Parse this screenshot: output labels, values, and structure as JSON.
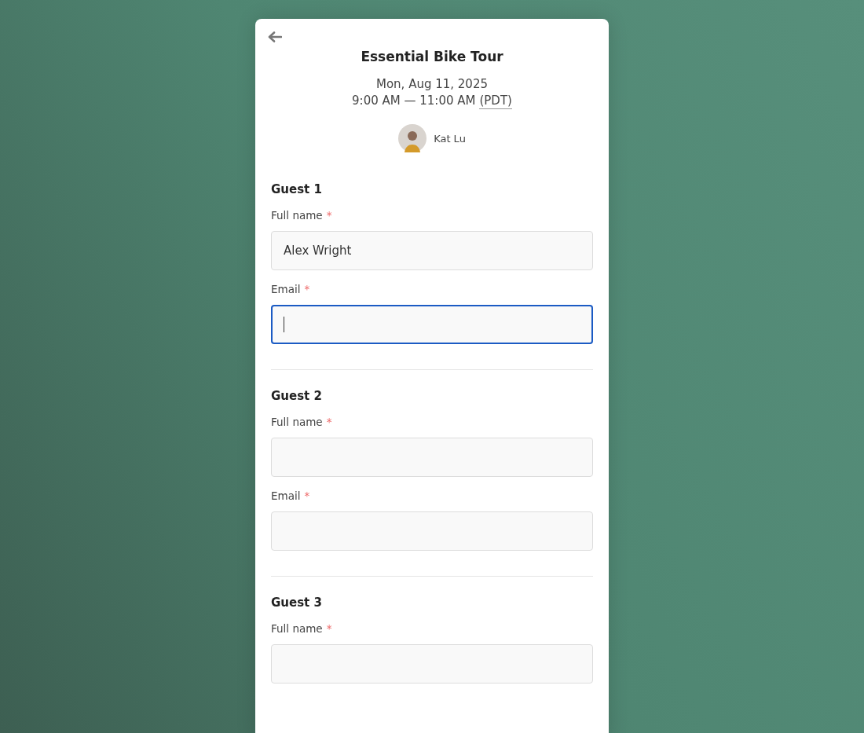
{
  "event": {
    "title": "Essential Bike Tour",
    "date": "Mon, Aug 11, 2025",
    "time": "9:00 AM — 11:00 AM",
    "timezone": "(PDT)",
    "host": "Kat Lu"
  },
  "guests": [
    {
      "heading": "Guest 1",
      "fields": [
        {
          "label": "Full name",
          "required_mark": "*",
          "value": "Alex Wright",
          "focused": false
        },
        {
          "label": "Email",
          "required_mark": "*",
          "focused": true
        }
      ]
    },
    {
      "heading": "Guest 2",
      "fields": [
        {
          "label": "Full name",
          "required_mark": "*",
          "focused": false
        },
        {
          "label": "Email",
          "required_mark": "*",
          "focused": false
        }
      ]
    },
    {
      "heading": "Guest 3",
      "fields": [
        {
          "label": "Full name",
          "required_mark": "*",
          "focused": false
        }
      ]
    }
  ]
}
